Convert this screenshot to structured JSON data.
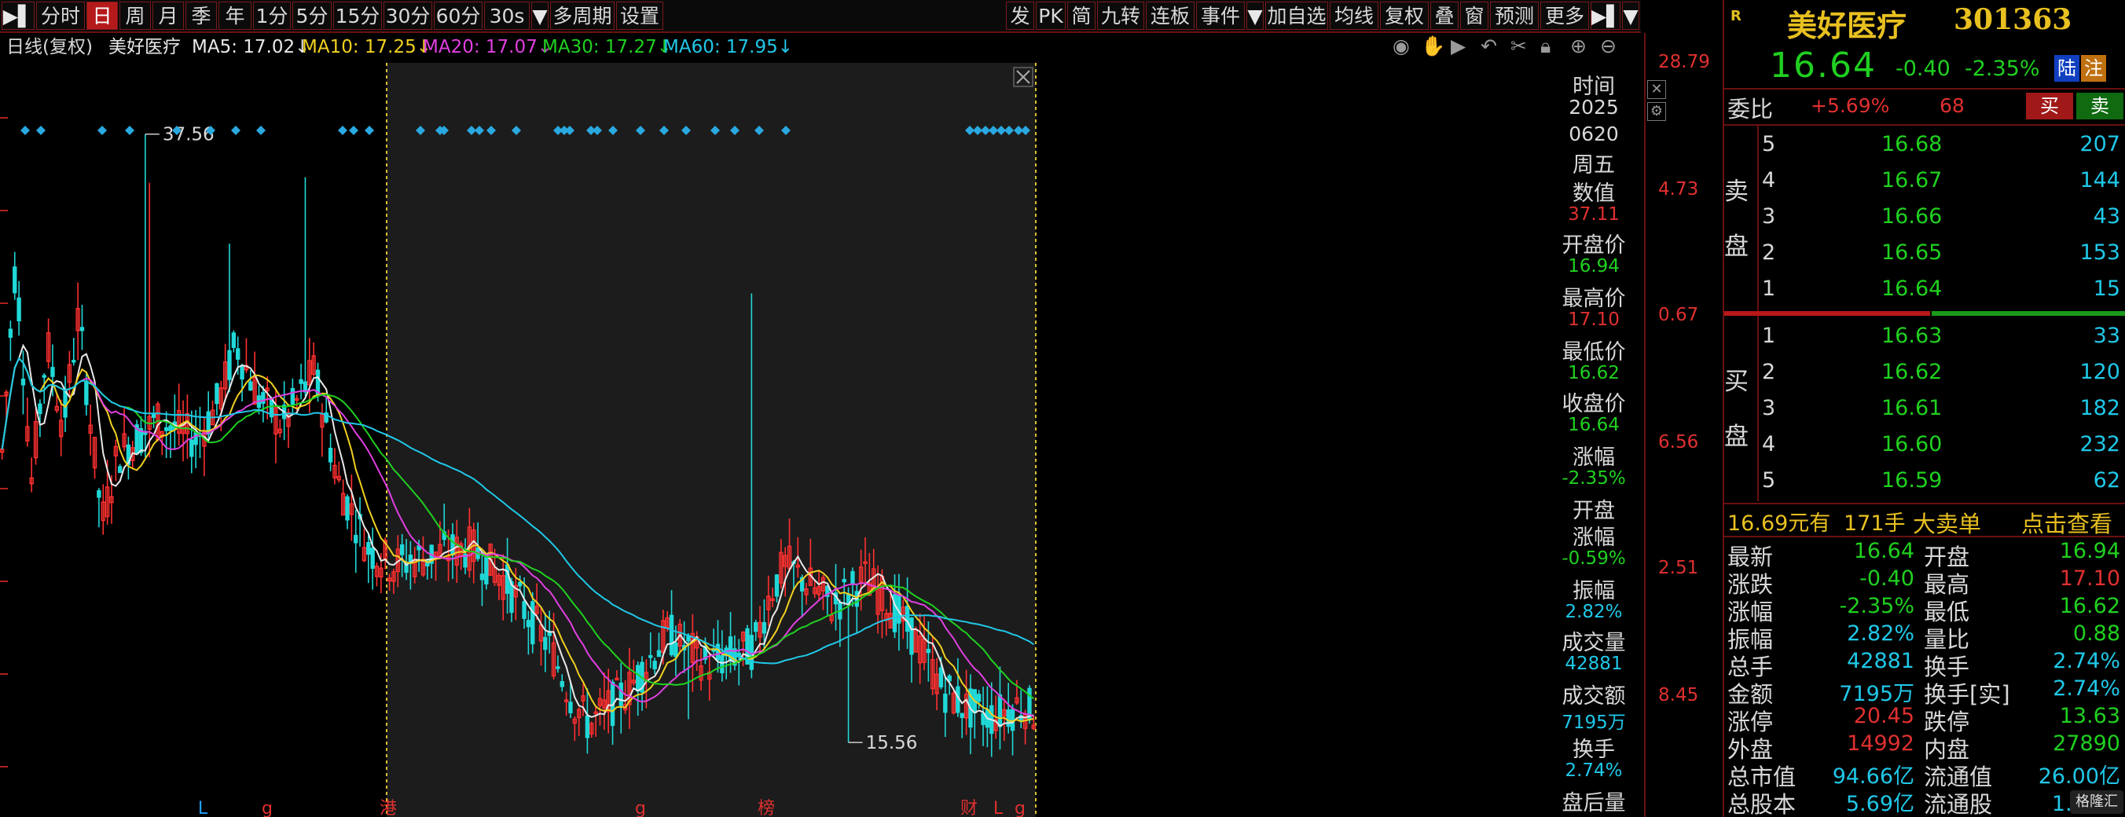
{
  "toolbar": {
    "left": [
      {
        "label": "▶▌",
        "w": 42,
        "icon": true
      },
      {
        "label": "分时",
        "w": 62
      },
      {
        "label": "日",
        "w": 40,
        "active": true
      },
      {
        "label": "周",
        "w": 40
      },
      {
        "label": "月",
        "w": 40
      },
      {
        "label": "季",
        "w": 40
      },
      {
        "label": "年",
        "w": 42
      },
      {
        "label": "1分",
        "w": 48
      },
      {
        "label": "5分",
        "w": 50
      },
      {
        "label": "15分",
        "w": 62
      },
      {
        "label": "30分",
        "w": 62
      },
      {
        "label": "60分",
        "w": 62
      },
      {
        "label": "30s",
        "w": 58
      },
      {
        "label": "▼",
        "w": 22,
        "icon": true
      },
      {
        "label": "多周期",
        "w": 82
      },
      {
        "label": "设置",
        "w": 60
      }
    ],
    "right": [
      {
        "label": "发",
        "w": 36
      },
      {
        "label": "PK",
        "w": 38
      },
      {
        "label": "简",
        "w": 36
      },
      {
        "label": "九转",
        "w": 60
      },
      {
        "label": "连板",
        "w": 62
      },
      {
        "label": "事件",
        "w": 62
      },
      {
        "label": "▼",
        "w": 22,
        "icon": true
      },
      {
        "label": "加自选",
        "w": 80
      },
      {
        "label": "均线",
        "w": 62
      },
      {
        "label": "复权",
        "w": 62
      },
      {
        "label": "叠",
        "w": 36
      },
      {
        "label": "窗",
        "w": 36
      },
      {
        "label": "预测",
        "w": 62
      },
      {
        "label": "更多",
        "w": 62
      },
      {
        "label": "▶▌",
        "w": 38,
        "icon": true
      },
      {
        "label": "▼",
        "w": 22,
        "icon": true
      }
    ]
  },
  "ma_line": {
    "mode": "日线(复权)",
    "stock": "美好医疗",
    "ma5": "MA5: 17.02↓",
    "ma10": "MA10: 17.25↓",
    "ma20": "MA20: 17.07↓",
    "ma30": "MA30: 17.27↓",
    "ma60": "MA60: 17.95↓"
  },
  "colors": {
    "ma5": "#e8e8e8",
    "ma10": "#f0d020",
    "ma20": "#e040e0",
    "ma30": "#20d020",
    "ma60": "#20c8e8",
    "up": "#ff3030",
    "down": "#20d8d8",
    "axis_red": "#e03030"
  },
  "chart_data": {
    "type": "candlestick",
    "high_label": "37.56",
    "low_label": "15.56",
    "axis_labels": [
      "28.79",
      "4.73",
      "0.67",
      "6.56",
      "2.51",
      "8.45"
    ],
    "event_marks": [
      {
        "label": "L",
        "color": "#20a0ff"
      },
      {
        "label": "g",
        "color": "#e03030"
      },
      {
        "label": "港",
        "color": "#e03030"
      },
      {
        "label": "g",
        "color": "#e03030"
      },
      {
        "label": "榜",
        "color": "#e03030"
      },
      {
        "label": "财",
        "color": "#e03030"
      },
      {
        "label": "L",
        "color": "#e03030"
      },
      {
        "label": "g",
        "color": "#e03030"
      }
    ]
  },
  "info": {
    "time_label": "时间",
    "year": "2025",
    "date": "0620",
    "weekday": "周五",
    "value_label": "数值",
    "value": "37.11",
    "open_label": "开盘价",
    "open": "16.94",
    "high_label": "最高价",
    "high": "17.10",
    "low_label": "最低价",
    "low": "16.62",
    "close_label": "收盘价",
    "close": "16.64",
    "chg_label": "涨幅",
    "chg": "-2.35%",
    "open_chg_label1": "开盘",
    "open_chg_label2": "涨幅",
    "open_chg": "-0.59%",
    "amp_label": "振幅",
    "amp": "2.82%",
    "vol_label": "成交量",
    "vol": "42881",
    "amt_label": "成交额",
    "amt": "7195万",
    "turn_label": "换手",
    "turn": "2.74%",
    "after_label": "盘后量"
  },
  "panel": {
    "r_badge": "R",
    "name": "美好医疗",
    "code": "301363",
    "price": "16.64",
    "change": "-0.40",
    "change_pct": "-2.35%",
    "tag1": "陆",
    "tag2": "注",
    "weibi_label": "委比",
    "weibi": "+5.69%",
    "weicha": "68",
    "buy_btn": "买",
    "sell_btn": "卖",
    "sell_label1": "卖",
    "sell_label2": "盘",
    "buy_label1": "买",
    "buy_label2": "盘",
    "asks": [
      {
        "lvl": "5",
        "price": "16.68",
        "vol": "207"
      },
      {
        "lvl": "4",
        "price": "16.67",
        "vol": "144"
      },
      {
        "lvl": "3",
        "price": "16.66",
        "vol": "43"
      },
      {
        "lvl": "2",
        "price": "16.65",
        "vol": "153"
      },
      {
        "lvl": "1",
        "price": "16.64",
        "vol": "15"
      }
    ],
    "bids": [
      {
        "lvl": "1",
        "price": "16.63",
        "vol": "33"
      },
      {
        "lvl": "2",
        "price": "16.62",
        "vol": "120"
      },
      {
        "lvl": "3",
        "price": "16.61",
        "vol": "182"
      },
      {
        "lvl": "4",
        "price": "16.60",
        "vol": "232"
      },
      {
        "lvl": "5",
        "price": "16.59",
        "vol": "62"
      }
    ],
    "big_price": "16.69元有",
    "big_qty": "171手",
    "big_type": "大卖单",
    "big_link": "点击查看",
    "stats": [
      {
        "l1": "最新",
        "v1": "16.64",
        "c1": "#20d020",
        "l2": "开盘",
        "v2": "16.94",
        "c2": "#20d020"
      },
      {
        "l1": "涨跌",
        "v1": "-0.40",
        "c1": "#20d020",
        "l2": "最高",
        "v2": "17.10",
        "c2": "#e03030"
      },
      {
        "l1": "涨幅",
        "v1": "-2.35%",
        "c1": "#20d020",
        "l2": "最低",
        "v2": "16.62",
        "c2": "#20d020"
      },
      {
        "l1": "振幅",
        "v1": "2.82%",
        "c1": "#20c8e8",
        "l2": "量比",
        "v2": "0.88",
        "c2": "#20d020"
      },
      {
        "l1": "总手",
        "v1": "42881",
        "c1": "#20c8e8",
        "l2": "换手",
        "v2": "2.74%",
        "c2": "#20c8e8"
      },
      {
        "l1": "金额",
        "v1": "7195万",
        "c1": "#20c8e8",
        "l2": "换手[实]",
        "v2": "2.74%",
        "c2": "#20c8e8"
      },
      {
        "l1": "涨停",
        "v1": "20.45",
        "c1": "#e03030",
        "l2": "跌停",
        "v2": "13.63",
        "c2": "#20d020"
      },
      {
        "l1": "外盘",
        "v1": "14992",
        "c1": "#e03030",
        "l2": "内盘",
        "v2": "27890",
        "c2": "#20d020"
      },
      {
        "l1": "总市值",
        "v1": "94.66亿",
        "c1": "#20c8e8",
        "l2": "流通值",
        "v2": "26.00亿",
        "c2": "#20c8e8"
      },
      {
        "l1": "总股本",
        "v1": "5.69亿",
        "c1": "#20c8e8",
        "l2": "流通股",
        "v2": "1.56亿",
        "c2": "#20c8e8"
      }
    ],
    "watermark": "格隆汇"
  }
}
